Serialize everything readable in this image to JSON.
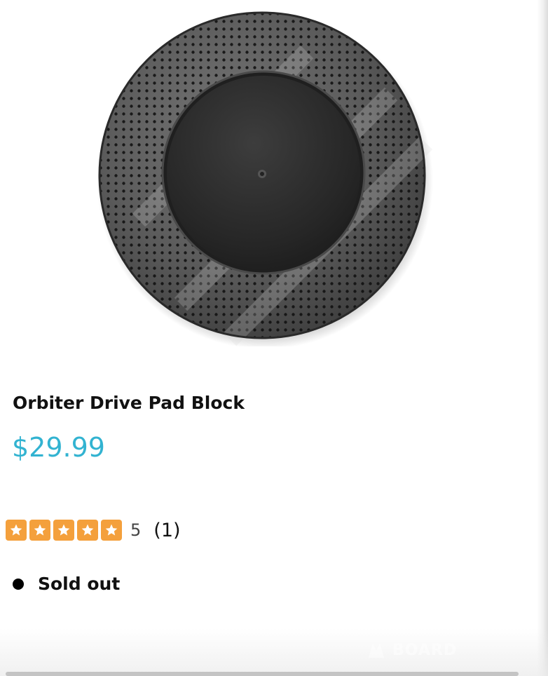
{
  "product": {
    "image_alt": "Orbiter Drive Pad Block",
    "title": "Orbiter Drive Pad Block",
    "price": "$29.99",
    "rating": {
      "value": "5",
      "count": "(1)",
      "stars_filled": 5,
      "stars_total": 5
    },
    "stock_status": "Sold out",
    "watermark_text": "BOARD"
  },
  "colors": {
    "price": "#32b3d1",
    "star_fill": "#f4a03c",
    "star_icon": "#ffffff",
    "title_text": "#111111",
    "stock_dot": "#000000"
  },
  "icons": {
    "star": "star-icon",
    "status_dot": "status-dot-icon",
    "watermark": "watermark-logo-icon"
  }
}
